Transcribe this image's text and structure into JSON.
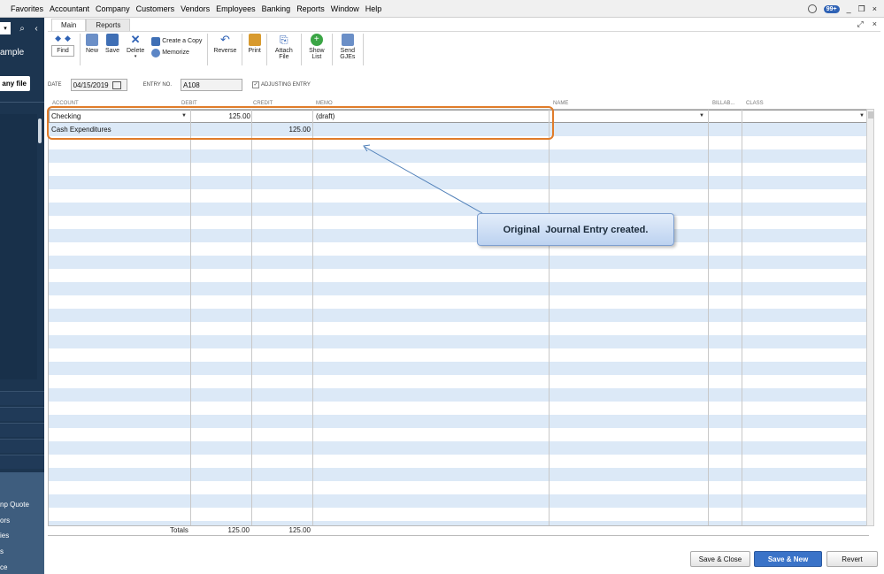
{
  "menubar": {
    "items": [
      "Favorites",
      "Accountant",
      "Company",
      "Customers",
      "Vendors",
      "Employees",
      "Banking",
      "Reports",
      "Window",
      "Help"
    ],
    "notification_count": "99+",
    "window_controls": [
      "_",
      "❒",
      "×"
    ]
  },
  "sidebar": {
    "company_label": "ample",
    "company_button": "any file",
    "links": [
      "np Quote",
      "ors",
      "ies",
      "s",
      "ce"
    ]
  },
  "tabs": [
    "Main",
    "Reports"
  ],
  "toolbar": {
    "find": "Find",
    "new": "New",
    "save": "Save",
    "delete": "Delete",
    "create_copy": "Create a Copy",
    "memorize": "Memorize",
    "reverse": "Reverse",
    "print": "Print",
    "attach_file": "Attach File",
    "show_list": "Show List",
    "send_gjes": "Send GJEs"
  },
  "form": {
    "date_label": "DATE",
    "date_value": "04/15/2019",
    "entry_no_label": "ENTRY NO.",
    "entry_no_value": "A108",
    "adjusting_label": "ADJUSTING ENTRY",
    "adjusting_checked": true
  },
  "grid": {
    "columns": [
      "ACCOUNT",
      "DEBIT",
      "CREDIT",
      "MEMO",
      "NAME",
      "BILLAB...",
      "CLASS"
    ],
    "rows": [
      {
        "account": "Checking",
        "debit": "125.00",
        "credit": "",
        "memo": "(draft)",
        "name": "",
        "billable": "",
        "class": ""
      },
      {
        "account": "Cash Expenditures",
        "debit": "",
        "credit": "125.00",
        "memo": "",
        "name": "",
        "billable": "",
        "class": ""
      }
    ],
    "totals_label": "Totals",
    "total_debit": "125.00",
    "total_credit": "125.00"
  },
  "callout": {
    "text": "Original  Journal Entry created."
  },
  "footer": {
    "save_close": "Save & Close",
    "save_new": "Save & New",
    "revert": "Revert"
  },
  "colors": {
    "accent": "#3a73c8",
    "highlight": "#e07c2a",
    "row_stripe": "#dce9f7",
    "sidebar": "#1c3550"
  }
}
